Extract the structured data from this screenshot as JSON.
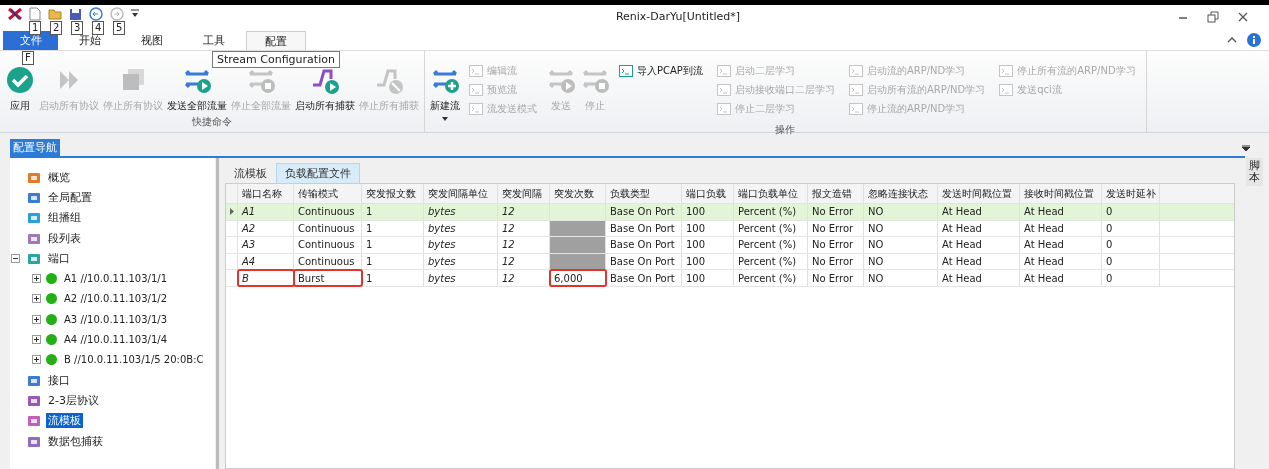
{
  "window": {
    "title": "Renix-DarYu[Untitled*]"
  },
  "quick_access": {
    "key_tips": [
      "1",
      "2",
      "3",
      "4",
      "5"
    ]
  },
  "tabs": [
    {
      "label": "文件",
      "kind": "file",
      "selected": false,
      "key_tip": "F"
    },
    {
      "label": "开始",
      "kind": "tab",
      "selected": false
    },
    {
      "label": "视图",
      "kind": "tab",
      "selected": false
    },
    {
      "label": "工具",
      "kind": "tab",
      "selected": false
    },
    {
      "label": "配置",
      "kind": "tab",
      "selected": true
    }
  ],
  "tooltip": "Stream Configuration",
  "ribbon": {
    "groups": [
      {
        "label": "快捷命令",
        "items": [
          {
            "kind": "large",
            "label": "应用",
            "disabled": false
          },
          {
            "kind": "large",
            "label": "启动所有协议",
            "disabled": true
          },
          {
            "kind": "large",
            "label": "停止所有协议",
            "disabled": true
          },
          {
            "kind": "large",
            "label": "发送全部流量",
            "disabled": false
          },
          {
            "kind": "large",
            "label": "停止全部流量",
            "disabled": true
          },
          {
            "kind": "large",
            "label": "启动所有捕获",
            "disabled": false
          },
          {
            "kind": "large",
            "label": "停止所有捕获",
            "disabled": true
          }
        ]
      },
      {
        "label": "操作",
        "items": [
          {
            "kind": "large",
            "label": "新建流",
            "disabled": false,
            "dropdown": true
          },
          {
            "kind": "stack",
            "items": [
              {
                "label": "编辑流",
                "disabled": true
              },
              {
                "label": "预览流",
                "disabled": true
              },
              {
                "label": "流发送模式",
                "disabled": true
              }
            ]
          },
          {
            "kind": "large",
            "label": "发送",
            "disabled": true
          },
          {
            "kind": "large",
            "label": "停止",
            "disabled": true
          },
          {
            "kind": "stack",
            "items": [
              {
                "label": "导入PCAP到流",
                "disabled": false
              }
            ]
          },
          {
            "kind": "stack",
            "items": [
              {
                "label": "启动二层学习",
                "disabled": true
              },
              {
                "label": "启动接收端口二层学习",
                "disabled": true
              },
              {
                "label": "停止二层学习",
                "disabled": true
              }
            ]
          },
          {
            "kind": "stack",
            "items": [
              {
                "label": "启动流的ARP/ND学习",
                "disabled": true
              },
              {
                "label": "启动所有流的ARP/ND学习",
                "disabled": true
              },
              {
                "label": "停止流的ARP/ND学习",
                "disabled": true
              }
            ]
          },
          {
            "kind": "stack",
            "items": [
              {
                "label": "停止所有流的ARP/ND学习",
                "disabled": true
              },
              {
                "label": "发送qci流",
                "disabled": true
              }
            ]
          }
        ]
      }
    ]
  },
  "navigator": {
    "title": "配置导航",
    "items": [
      {
        "label": "概览",
        "selected": false
      },
      {
        "label": "全局配置",
        "selected": false
      },
      {
        "label": "组播组",
        "selected": false
      },
      {
        "label": "段列表",
        "selected": false
      },
      {
        "label": "端口",
        "selected": false,
        "expanded": true,
        "children": [
          {
            "label": "A1 //10.0.11.103/1/1",
            "selected": false,
            "expanded": false,
            "color": "#22b014"
          },
          {
            "label": "A2 //10.0.11.103/1/2",
            "selected": false,
            "expanded": false,
            "color": "#22b014"
          },
          {
            "label": "A3 //10.0.11.103/1/3",
            "selected": false,
            "expanded": false,
            "color": "#22b014"
          },
          {
            "label": "A4 //10.0.11.103/1/4",
            "selected": false,
            "expanded": false,
            "color": "#22b014"
          },
          {
            "label": "B //10.0.11.103/1/5 20:0B:C",
            "selected": false,
            "expanded": false,
            "color": "#22b014"
          }
        ]
      },
      {
        "label": "接口",
        "selected": false
      },
      {
        "label": "2-3层协议",
        "selected": false
      },
      {
        "label": "流模板",
        "selected": true
      },
      {
        "label": "数据包捕获",
        "selected": false
      }
    ]
  },
  "content_tabs": [
    {
      "label": "流模板",
      "selected": false
    },
    {
      "label": "负载配置文件",
      "selected": true
    }
  ],
  "side_tab": "脚本",
  "table": {
    "columns": [
      "端口名称",
      "传输模式",
      "突发报文数",
      "突发间隔单位",
      "突发间隔",
      "突发次数",
      "负载类型",
      "端口负载",
      "端口负载单位",
      "报文造错",
      "忽略连接状态",
      "发送时间戳位置",
      "接收时间戳位置",
      "发送时延补"
    ],
    "rows": [
      {
        "selected": true,
        "cells": [
          "A1",
          "Continuous",
          "1",
          "bytes",
          "12",
          {
            "disabled": false
          },
          "Base On Port",
          "100",
          "Percent (%)",
          "No Error",
          "NO",
          "At Head",
          "At Head",
          "0"
        ]
      },
      {
        "selected": false,
        "cells": [
          "A2",
          "Continuous",
          "1",
          "bytes",
          "12",
          {
            "disabled": true
          },
          "Base On Port",
          "100",
          "Percent (%)",
          "No Error",
          "NO",
          "At Head",
          "At Head",
          "0"
        ]
      },
      {
        "selected": false,
        "cells": [
          "A3",
          "Continuous",
          "1",
          "bytes",
          "12",
          {
            "disabled": true
          },
          "Base On Port",
          "100",
          "Percent (%)",
          "No Error",
          "NO",
          "At Head",
          "At Head",
          "0"
        ]
      },
      {
        "selected": false,
        "cells": [
          "A4",
          "Continuous",
          "1",
          "bytes",
          "12",
          {
            "disabled": true
          },
          "Base On Port",
          "100",
          "Percent (%)",
          "No Error",
          "NO",
          "At Head",
          "At Head",
          "0"
        ]
      },
      {
        "selected": false,
        "cells": [
          {
            "text": "B",
            "boxed": true
          },
          {
            "text": "Burst",
            "boxed": true
          },
          "1",
          "bytes",
          "12",
          {
            "text": "6,000",
            "boxed": true,
            "disabled": false
          },
          "Base On Port",
          "100",
          "Percent (%)",
          "No Error",
          "NO",
          "At Head",
          "At Head",
          "0"
        ]
      }
    ]
  }
}
